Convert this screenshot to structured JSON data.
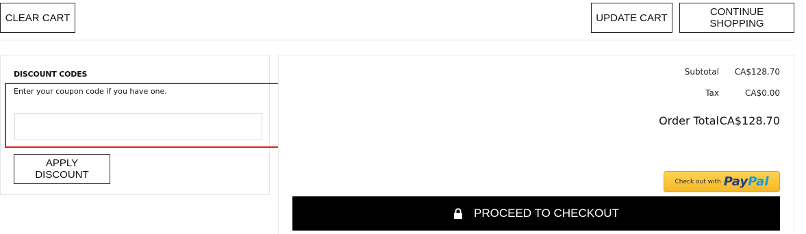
{
  "cart_actions": {
    "clear_label": "CLEAR CART",
    "update_label": "UPDATE CART",
    "continue_label": "CONTINUE SHOPPING"
  },
  "discount": {
    "title": "DISCOUNT CODES",
    "hint": "Enter your coupon code if you have one.",
    "input_value": "",
    "apply_label": "APPLY DISCOUNT"
  },
  "summary": {
    "subtotal_label": "Subtotal",
    "subtotal_value": "CA$128.70",
    "tax_label": "Tax",
    "tax_value": "CA$0.00",
    "total_label": "Order Total",
    "total_value": "CA$128.70"
  },
  "paypal": {
    "prefix": "Check out with",
    "logo_pay": "Pay",
    "logo_pal": "Pal"
  },
  "checkout": {
    "label": "PROCEED TO CHECKOUT",
    "icon": "lock-icon"
  },
  "colors": {
    "highlight": "#e31b1b",
    "checkout_bg": "#000000",
    "paypal_bg": "#ffc439"
  }
}
